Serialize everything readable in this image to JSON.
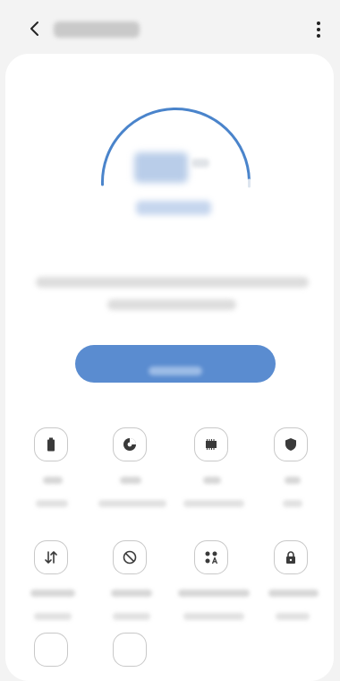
{
  "header": {
    "title": "",
    "back_icon": "back-arrow-icon",
    "more_icon": "more-options-icon"
  },
  "status": {
    "score": "",
    "score_unit": "",
    "score_detail": ""
  },
  "main": {
    "description": "",
    "button_label": ""
  },
  "features": [
    {
      "icon": "battery-icon",
      "label": "",
      "value": ""
    },
    {
      "icon": "storage-pie-icon",
      "label": "",
      "value": ""
    },
    {
      "icon": "memory-chip-icon",
      "label": "",
      "value": ""
    },
    {
      "icon": "shield-icon",
      "label": "",
      "value": ""
    },
    {
      "icon": "data-transfer-icon",
      "label": "",
      "value": ""
    },
    {
      "icon": "block-icon",
      "label": "",
      "value": ""
    },
    {
      "icon": "apps-grid-icon",
      "label": "",
      "value": ""
    },
    {
      "icon": "lock-icon",
      "label": "",
      "value": ""
    }
  ],
  "colors": {
    "accent": "#5a8cd0",
    "background": "#f3f3f3",
    "card": "#ffffff",
    "icon": "#3a3a3a"
  }
}
